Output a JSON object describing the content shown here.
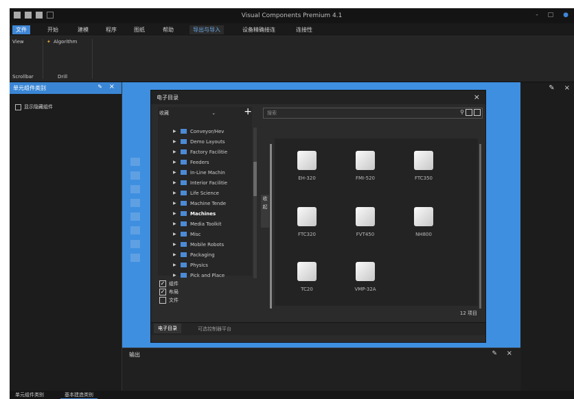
{
  "window": {
    "title": "Visual Components Premium 4.1",
    "controls": [
      "-",
      "□",
      "●"
    ]
  },
  "menu": {
    "items": [
      {
        "label": "文件",
        "state": "active"
      },
      {
        "label": "开始",
        "state": ""
      },
      {
        "label": "建模",
        "state": ""
      },
      {
        "label": "程序",
        "state": ""
      },
      {
        "label": "图纸",
        "state": ""
      },
      {
        "label": "帮助",
        "state": ""
      },
      {
        "label": "导出与导入",
        "state": "sel"
      },
      {
        "label": "设备精确接连",
        "state": ""
      },
      {
        "label": "连接性",
        "state": ""
      }
    ]
  },
  "ribbon": {
    "view_label": "View",
    "algorithm_label": "Algorithm",
    "group1": "Scrollbar",
    "group2": "Drill"
  },
  "left_panel": {
    "title": "单元组件类别",
    "checkbox_label": "显示隐藏组件"
  },
  "catalog": {
    "title": "电子目录",
    "tree_header": "收藏",
    "search_placeholder": "搜索",
    "collapse_label": "收起",
    "tree_items": [
      {
        "label": "Conveyor/Hev",
        "bold": false
      },
      {
        "label": "Demo Layouts",
        "bold": false
      },
      {
        "label": "Factory Facilitie",
        "bold": false
      },
      {
        "label": "Feeders",
        "bold": false
      },
      {
        "label": "In-Line Machin",
        "bold": false
      },
      {
        "label": "Interior Facilitie",
        "bold": false
      },
      {
        "label": "Life Science",
        "bold": false
      },
      {
        "label": "Machine Tende",
        "bold": false
      },
      {
        "label": "Machines",
        "bold": true
      },
      {
        "label": "Media Toolkit",
        "bold": false
      },
      {
        "label": "Misc",
        "bold": false
      },
      {
        "label": "Mobile Robots",
        "bold": false
      },
      {
        "label": "Packaging",
        "bold": false
      },
      {
        "label": "Physics",
        "bold": false
      },
      {
        "label": "Pick and Place",
        "bold": false
      }
    ],
    "filters": [
      {
        "label": "组件",
        "checked": true
      },
      {
        "label": "布局",
        "checked": true
      },
      {
        "label": "文件",
        "checked": false
      }
    ],
    "items": [
      {
        "label": "EH-320"
      },
      {
        "label": "FMI-520"
      },
      {
        "label": "FTC350"
      },
      {
        "label": "FTC320"
      },
      {
        "label": "FVT450"
      },
      {
        "label": "NH800"
      },
      {
        "label": "TC20"
      },
      {
        "label": "VMP-32A"
      }
    ],
    "footer_text": "12 项目",
    "tabs": [
      {
        "label": "电子目录",
        "active": true
      },
      {
        "label": "可选控制器平台",
        "active": false
      }
    ]
  },
  "output_panel": {
    "title": "输出"
  },
  "bottom_tabs": [
    "单元组件类别",
    "基本建造类别"
  ]
}
